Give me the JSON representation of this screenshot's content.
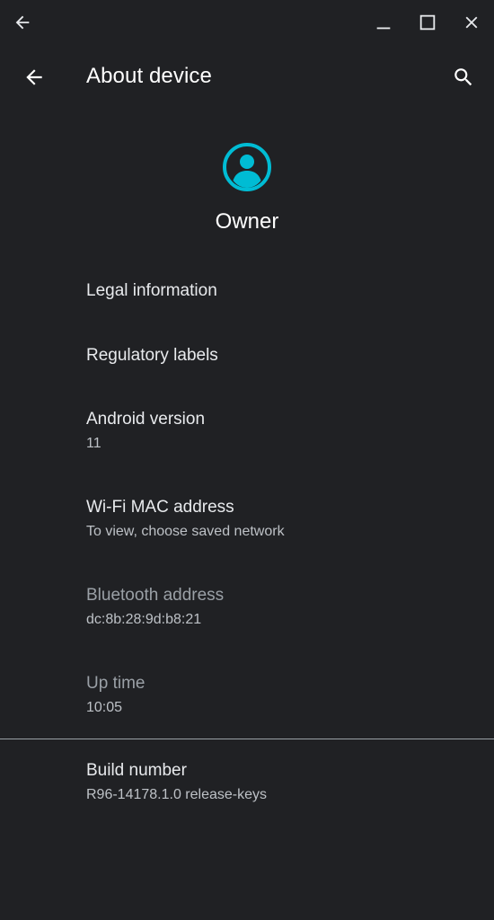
{
  "window": {
    "controls": {
      "back_icon": "arrow-left-icon",
      "minimize_icon": "minimize-icon",
      "maximize_icon": "maximize-icon",
      "close_icon": "close-icon"
    }
  },
  "appbar": {
    "title": "About device",
    "back_icon": "arrow-left-icon",
    "search_icon": "search-icon"
  },
  "profile": {
    "name": "Owner",
    "avatar_icon": "account-circle-icon",
    "accent_color": "#00bcd4"
  },
  "items": [
    {
      "title": "Legal information",
      "summary": ""
    },
    {
      "title": "Regulatory labels",
      "summary": ""
    },
    {
      "title": "Android version",
      "summary": "11"
    },
    {
      "title": "Wi-Fi MAC address",
      "summary": "To view, choose saved network"
    },
    {
      "title": "Bluetooth address",
      "summary": "dc:8b:28:9d:b8:21"
    },
    {
      "title": "Up time",
      "summary": "10:05"
    },
    {
      "title": "Build number",
      "summary": "R96-14178.1.0 release-keys"
    }
  ],
  "colors": {
    "background": "#202124",
    "primary_text": "#e8eaed",
    "secondary_text": "#bdc1c6",
    "disabled_text": "#9aa0a6",
    "accent": "#00bcd4"
  }
}
